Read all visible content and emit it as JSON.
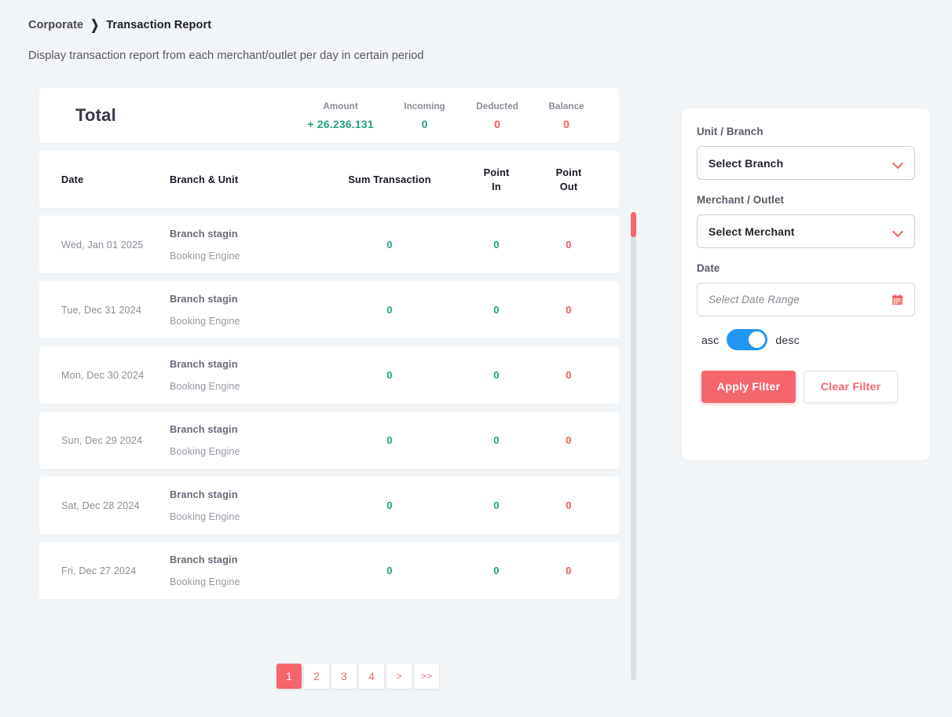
{
  "breadcrumb": {
    "parent": "Corporate",
    "separator": "❯",
    "current": "Transaction Report"
  },
  "subtitle": "Display transaction report from each merchant/outlet per day in certain period",
  "summary": {
    "label": "Total",
    "metrics": [
      {
        "name": "Amount",
        "value": "+ 26.236.131",
        "tone": "pos"
      },
      {
        "name": "Incoming",
        "value": "0",
        "tone": "pos"
      },
      {
        "name": "Deducted",
        "value": "0",
        "tone": "neg"
      },
      {
        "name": "Balance",
        "value": "0",
        "tone": "neg"
      }
    ]
  },
  "table": {
    "columns": [
      "Date",
      "Branch & Unit",
      "Sum Transaction",
      "Point\nIn",
      "Point\nOut"
    ],
    "headers": {
      "date": "Date",
      "branch": "Branch & Unit",
      "sum": "Sum Transaction",
      "point_in_line1": "Point",
      "point_in_line2": "In",
      "point_out_line1": "Point",
      "point_out_line2": "Out"
    },
    "rows": [
      {
        "date": "Wed, Jan 01 2025",
        "branch": "Branch stagin",
        "unit": "Booking Engine",
        "sum": "0",
        "point_in": "0",
        "point_out": "0"
      },
      {
        "date": "Tue, Dec 31 2024",
        "branch": "Branch stagin",
        "unit": "Booking Engine",
        "sum": "0",
        "point_in": "0",
        "point_out": "0"
      },
      {
        "date": "Mon, Dec 30 2024",
        "branch": "Branch stagin",
        "unit": "Booking Engine",
        "sum": "0",
        "point_in": "0",
        "point_out": "0"
      },
      {
        "date": "Sun, Dec 29 2024",
        "branch": "Branch stagin",
        "unit": "Booking Engine",
        "sum": "0",
        "point_in": "0",
        "point_out": "0"
      },
      {
        "date": "Sat, Dec 28 2024",
        "branch": "Branch stagin",
        "unit": "Booking Engine",
        "sum": "0",
        "point_in": "0",
        "point_out": "0"
      },
      {
        "date": "Fri, Dec 27 2024",
        "branch": "Branch stagin",
        "unit": "Booking Engine",
        "sum": "0",
        "point_in": "0",
        "point_out": "0"
      }
    ]
  },
  "pagination": {
    "pages": [
      "1",
      "2",
      "3",
      "4"
    ],
    "active": "1",
    "next": ">",
    "last": ">>"
  },
  "filter": {
    "unit_branch_label": "Unit / Branch",
    "branch_select_value": "Select Branch",
    "merchant_label": "Merchant / Outlet",
    "merchant_select_value": "Select Merchant",
    "date_label": "Date",
    "date_placeholder": "Select Date Range",
    "sort_asc_label": "asc",
    "sort_desc_label": "desc",
    "sort_selected": "desc",
    "apply_label": "Apply Filter",
    "clear_label": "Clear Filter"
  },
  "colors": {
    "accent": "#f4666c",
    "positive": "#1fa085",
    "negative": "#f2555c",
    "toggle_on": "#2196f3",
    "page_bg": "#f2f5f7"
  }
}
